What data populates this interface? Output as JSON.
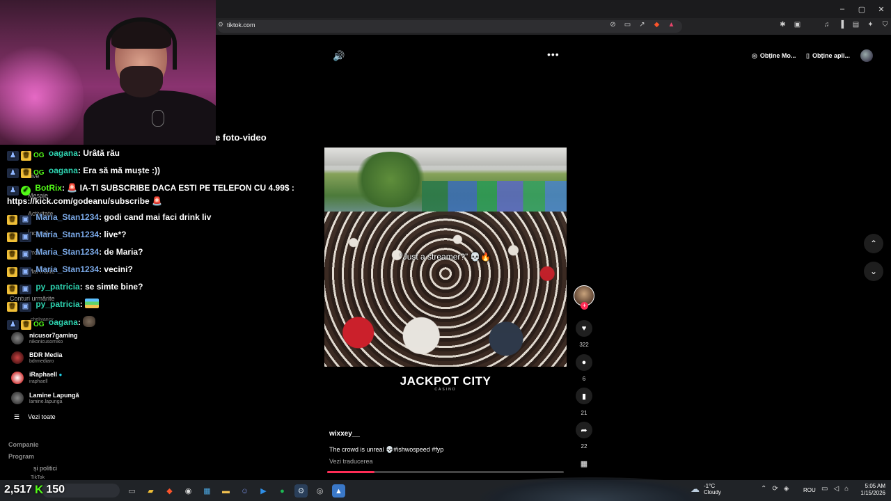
{
  "browser": {
    "url": "tiktok.com",
    "window_controls": [
      "–",
      "▢",
      "✕"
    ]
  },
  "header": {
    "get_mode_label": "Obține Mo...",
    "get_app_label": "Obține apli..."
  },
  "page": {
    "partial_title": "e foto-video"
  },
  "video": {
    "overlay_caption": "“Just a streamer?” 💀🔥",
    "brand": "JACKPOT CITY",
    "brand_sub": "CASINO",
    "author": "wixxey__",
    "description": "The crowd is unreal 💀#ishwospeed #fyp",
    "translate_label": "Vezi traducerea",
    "progress": 0.2
  },
  "actions": {
    "likes": "322",
    "comments": "6",
    "saves": "21",
    "shares": "22"
  },
  "sidebar": {
    "following": [
      {
        "name": "nicusor7gaming",
        "handle": "nikonicusorniko",
        "verified": false
      },
      {
        "name": "BDR Media",
        "handle": "bdrmediaro",
        "verified": false
      },
      {
        "name": "iRaphaell",
        "handle": "iraphaell",
        "verified": true
      },
      {
        "name": "Lamine Lapungă",
        "handle": "lamine.lapunga",
        "verified": false
      }
    ],
    "partial_handle": "chelivancv",
    "see_all": "Vezi toate",
    "footer": {
      "company": "Companie",
      "program": "Program",
      "policies": "și politici",
      "tiktok": "TikTok"
    },
    "faint_items": [
      "Live",
      "Mesaje",
      "Activitate",
      "Încarcă",
      "Profil",
      "Mai multe",
      "Conturi urmărite"
    ]
  },
  "chat": {
    "messages": [
      {
        "user": "oagana",
        "text": "Urâtă rău"
      },
      {
        "user": "oagana",
        "text": "Era să mă muște :))"
      },
      {
        "user": "BotRix",
        "text": "🚨 IA-TI SUBSCRIBE DACA ESTI PE TELEFON CU 4.99$ : https://kick.com/godeanu/subscribe 🚨"
      },
      {
        "user": "Maria_Stan1234",
        "text": "godi cand mai faci drink liv"
      },
      {
        "user": "Maria_Stan1234",
        "text": "live*?"
      },
      {
        "user": "Maria_Stan1234",
        "text": "de Maria?"
      },
      {
        "user": "Maria_Stan1234",
        "text": "vecini?"
      },
      {
        "user": "py_patricia",
        "text": "se simte bine?"
      },
      {
        "user": "py_patricia",
        "text": ""
      },
      {
        "user": "oagana",
        "text": ""
      }
    ],
    "og_badge": "OG"
  },
  "stream": {
    "viewers": "2,517",
    "kick_letter": "K",
    "followers": "150"
  },
  "taskbar": {
    "weather_temp": "-1°C",
    "weather_desc": "Cloudy",
    "lang": "ROU",
    "time": "5:05 AM",
    "date": "1/15/2026"
  }
}
